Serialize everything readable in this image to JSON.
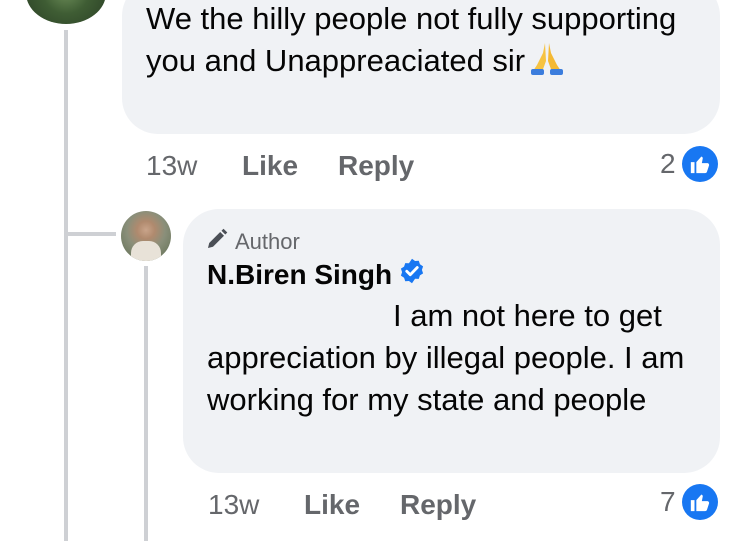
{
  "parent_comment": {
    "text": "We the hilly people not fully supporting you and Unappreaciated sir",
    "emoji_icon": "folded-hands-emoji",
    "time": "13w",
    "like_label": "Like",
    "reply_label": "Reply",
    "reaction_count": "2"
  },
  "reply_comment": {
    "badge_label": "Author",
    "author_name": "N.Biren Singh",
    "verified_icon": "verified-badge-icon",
    "text": "I am not here to get appreciation by illegal people. I am working for my state and people",
    "time": "13w",
    "like_label": "Like",
    "reply_label": "Reply",
    "reaction_count": "7"
  },
  "colors": {
    "bubble_bg": "#f0f2f5",
    "meta_text": "#65676b",
    "like_blue": "#1877f2",
    "thread_line": "#ced0d4"
  }
}
